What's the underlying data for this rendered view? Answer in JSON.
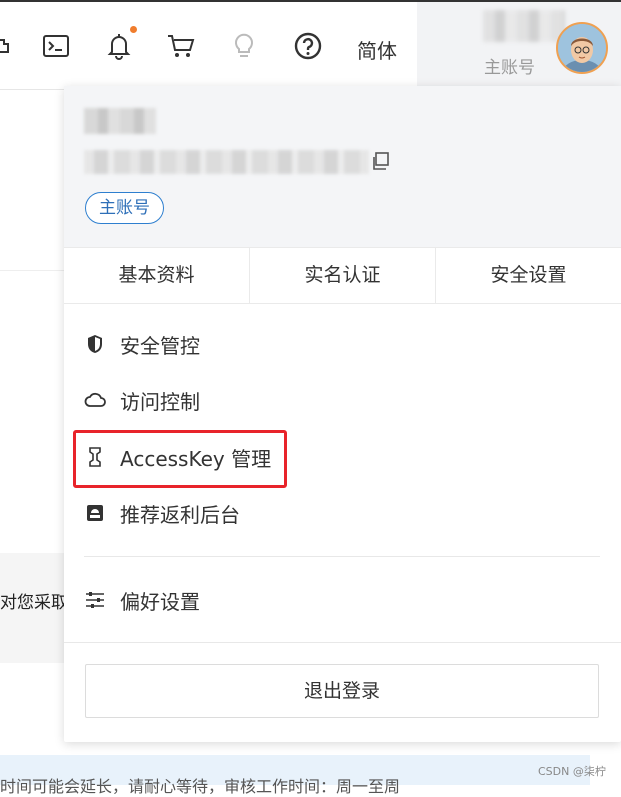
{
  "header": {
    "icons": [
      "plugin-icon",
      "terminal-icon",
      "bell-icon",
      "cart-icon",
      "bulb-icon",
      "help-icon"
    ],
    "language": "简体",
    "account_label": "主账号",
    "notification_dot_color": "#f07d2d"
  },
  "dropdown": {
    "badge": "主账号",
    "tabs": [
      "基本资料",
      "实名认证",
      "安全设置"
    ],
    "menu": [
      {
        "label": "安全管控",
        "icon": "shield-icon"
      },
      {
        "label": "访问控制",
        "icon": "cloud-icon"
      },
      {
        "label": "AccessKey 管理",
        "icon": "key-bracket-icon"
      },
      {
        "label": "推荐返利后台",
        "icon": "screen-icon"
      },
      {
        "label": "偏好设置",
        "icon": "sliders-icon"
      }
    ],
    "logout": "退出登录",
    "highlight_color": "#e8232a"
  },
  "background": {
    "side_text": "对您采取",
    "bottom_text": "时间可能会延长，请耐心等待，审核工作时间：周一至周"
  },
  "watermark": "CSDN @柒柠"
}
